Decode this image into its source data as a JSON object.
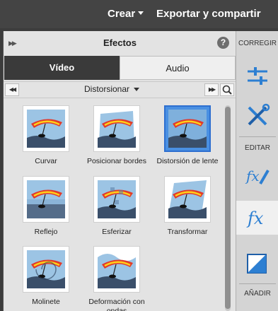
{
  "topbar": {
    "create_label": "Crear",
    "export_label": "Exportar y compartir"
  },
  "panel": {
    "title": "Efectos",
    "help": "?",
    "tabs": [
      {
        "label": "Vídeo",
        "active": true
      },
      {
        "label": "Audio",
        "active": false
      }
    ],
    "category": "Distorsionar",
    "effects": [
      {
        "label_lines": [
          "Curvar"
        ],
        "selected": false
      },
      {
        "label_lines": [
          "Posicionar bordes"
        ],
        "selected": false
      },
      {
        "label_lines": [
          "Distorsión de lente"
        ],
        "selected": true
      },
      {
        "label_lines": [
          "Reflejo"
        ],
        "selected": false
      },
      {
        "label_lines": [
          "Esferizar"
        ],
        "selected": false
      },
      {
        "label_lines": [
          "Transformar"
        ],
        "selected": false
      },
      {
        "label_lines": [
          "Molinete"
        ],
        "selected": false
      },
      {
        "label_lines": [
          "Deformación con",
          "ondas"
        ],
        "selected": false
      }
    ]
  },
  "sidebar": {
    "corregir_label": "CORREGIR",
    "editar_label": "EDITAR",
    "anadir_label": "AÑADIR",
    "tools": [
      {
        "icon": "sliders-icon",
        "active": false
      },
      {
        "icon": "tools-icon",
        "active": false
      },
      {
        "icon": "fx-edit-icon",
        "active": false
      },
      {
        "icon": "fx-icon",
        "active": true
      },
      {
        "icon": "transition-icon",
        "active": false
      }
    ]
  },
  "colors": {
    "accent_blue": "#2d7fd2",
    "selected_border": "#2d6fd0",
    "dark_tab": "#3a3a3a"
  }
}
